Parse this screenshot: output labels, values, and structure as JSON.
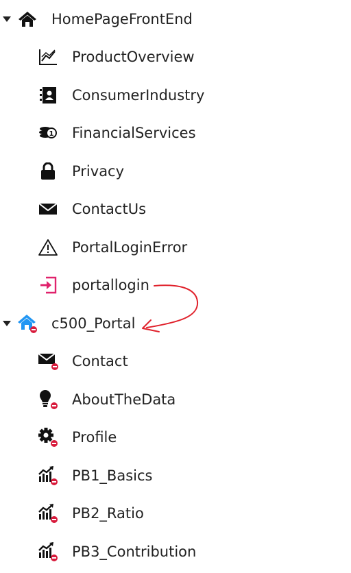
{
  "tree": {
    "groups": [
      {
        "name": "HomePageFrontEnd",
        "expanded": true,
        "icon": "home-icon",
        "children": [
          {
            "label": "ProductOverview",
            "icon": "chart-line-icon"
          },
          {
            "label": "ConsumerIndustry",
            "icon": "address-book-icon"
          },
          {
            "label": "FinancialServices",
            "icon": "coins-icon"
          },
          {
            "label": "Privacy",
            "icon": "lock-icon"
          },
          {
            "label": "ContactUs",
            "icon": "envelope-icon"
          },
          {
            "label": "PortalLoginError",
            "icon": "warning-icon"
          },
          {
            "label": "portallogin",
            "icon": "sign-in-icon",
            "color": "#e0226c"
          }
        ]
      },
      {
        "name": "c500_Portal",
        "expanded": true,
        "icon": "home-restricted-icon",
        "icon_color": "#2196f3",
        "children": [
          {
            "label": "Contact",
            "icon": "envelope-restricted-icon"
          },
          {
            "label": "AboutTheData",
            "icon": "lightbulb-restricted-icon"
          },
          {
            "label": "Profile",
            "icon": "gear-restricted-icon"
          },
          {
            "label": "PB1_Basics",
            "icon": "chart-restricted-icon"
          },
          {
            "label": "PB2_Ratio",
            "icon": "chart-restricted-icon"
          },
          {
            "label": "PB3_Contribution",
            "icon": "chart-restricted-icon"
          }
        ]
      }
    ]
  },
  "colors": {
    "annotation": "#e0212b",
    "restricted_badge": "#d81b3c",
    "accent_blue": "#2196f3",
    "accent_pink": "#e0226c"
  }
}
